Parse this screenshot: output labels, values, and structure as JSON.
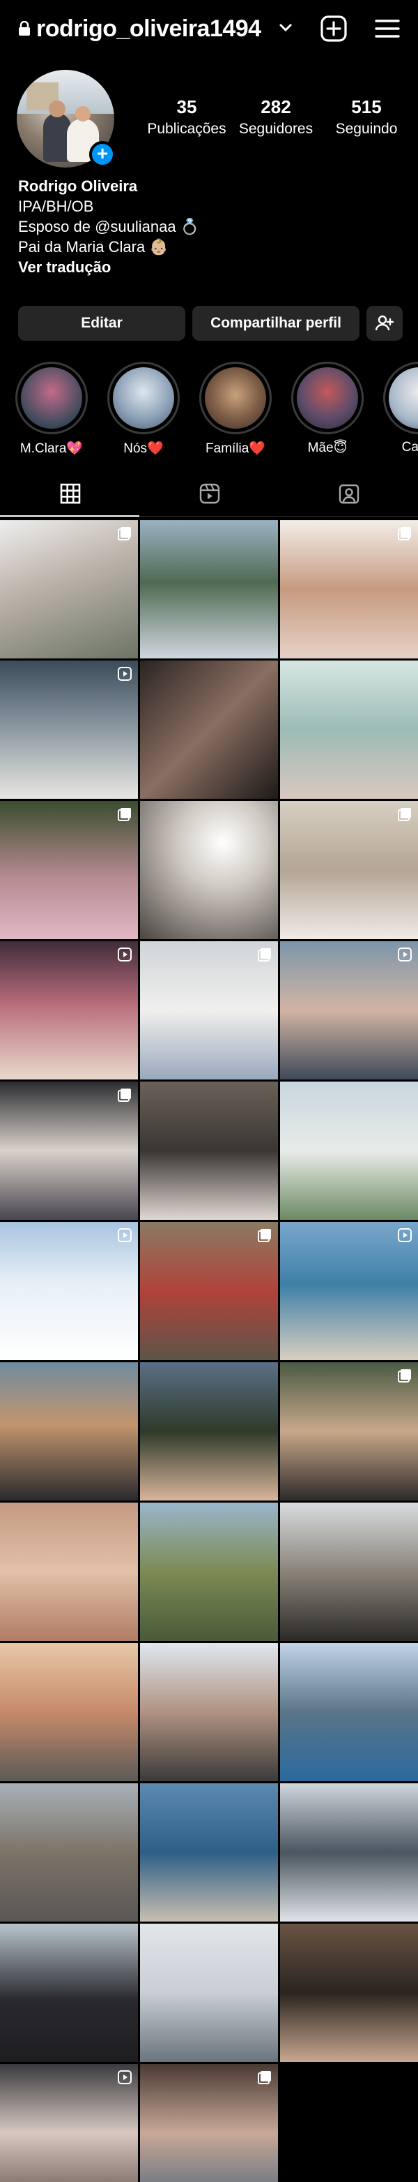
{
  "header": {
    "username": "rodrigo_oliveira1494"
  },
  "icons": {
    "lock": "lock-icon",
    "chevron": "chevron-down-icon",
    "create": "plus-square-icon",
    "menu": "hamburger-menu-icon",
    "add_story": "plus-icon",
    "add_user": "add-person-icon",
    "tab_grid": "grid-icon",
    "tab_reels": "reels-icon",
    "tab_tagged": "tagged-person-icon"
  },
  "stats": {
    "posts": {
      "value": "35",
      "label": "Publicações"
    },
    "followers": {
      "value": "282",
      "label": "Seguidores"
    },
    "following": {
      "value": "515",
      "label": "Seguindo"
    }
  },
  "bio": {
    "name": "Rodrigo Oliveira",
    "lines": [
      "IPA/BH/OB",
      "Esposo de @suulianaa 💍",
      "Pai da Maria Clara 👶🏼"
    ],
    "translate": "Ver tradução"
  },
  "actions": {
    "edit": "Editar",
    "share": "Compartilhar perfil"
  },
  "highlights": [
    {
      "label": "M.Clara💖"
    },
    {
      "label": "Nós❤️"
    },
    {
      "label": "Família❤️"
    },
    {
      "label": "Mãe😇"
    },
    {
      "label": "Casar"
    }
  ],
  "colors": {
    "background": "#000000",
    "button": "#262626",
    "accent": "#0095f6"
  }
}
